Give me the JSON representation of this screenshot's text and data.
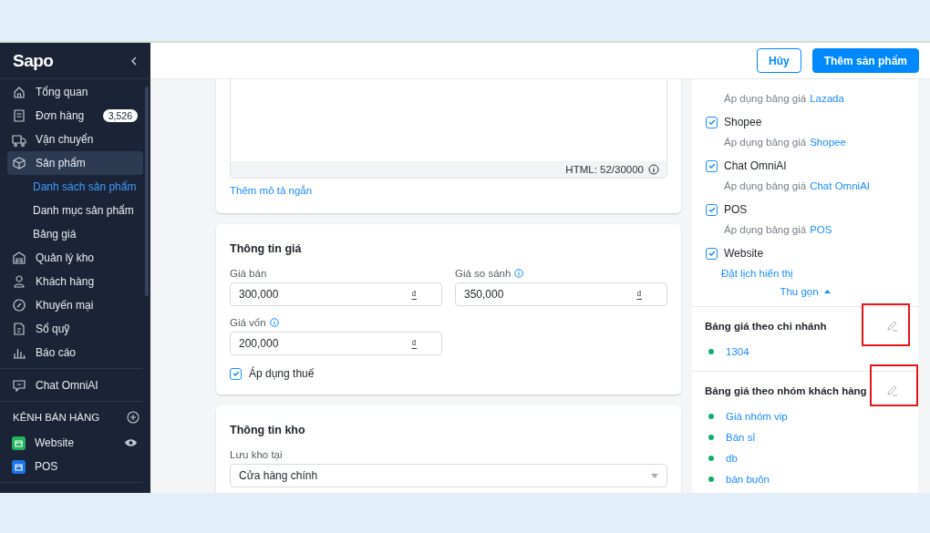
{
  "sidebar": {
    "logo": "Sapo",
    "items": [
      {
        "label": "Tổng quan",
        "selected": false
      },
      {
        "label": "Đơn hàng",
        "badge": "3,526",
        "selected": false
      },
      {
        "label": "Vận chuyển",
        "selected": false
      },
      {
        "label": "Sản phẩm",
        "selected": true,
        "children": [
          {
            "label": "Danh sách sản phẩm",
            "selected": true
          },
          {
            "label": "Danh mục sản phẩm",
            "selected": false
          },
          {
            "label": "Bảng giá",
            "selected": false
          }
        ]
      },
      {
        "label": "Quản lý kho",
        "selected": false
      },
      {
        "label": "Khách hàng",
        "selected": false
      },
      {
        "label": "Khuyến mại",
        "selected": false
      },
      {
        "label": "Sổ quỹ",
        "selected": false
      },
      {
        "label": "Báo cáo",
        "selected": false
      }
    ],
    "chat_item": {
      "label": "Chat OmniAI",
      "selected": false
    },
    "sales_channels": {
      "title": "KÊNH BÁN HÀNG",
      "items": [
        {
          "label": "Website",
          "color": "#22b35e",
          "selected": false
        },
        {
          "label": "POS",
          "color": "#1a73e8",
          "selected": false
        }
      ]
    }
  },
  "topbar": {
    "buttons": [
      {
        "label": "Hủy",
        "kind": "outline"
      },
      {
        "label": "Thêm sản phẩm",
        "kind": "primary"
      }
    ]
  },
  "description_card": {
    "counter": "HTML: 52/30000",
    "link": "Thêm mô tả ngắn"
  },
  "price_card": {
    "title": "Thông tin giá",
    "fields": [
      {
        "label": "Giá bán",
        "value": "300,000",
        "unit": "₫",
        "info": false
      },
      {
        "label": "Giá so sánh",
        "value": "350,000",
        "unit": "₫",
        "info": true
      },
      {
        "label": "Giá vốn",
        "value": "200,000",
        "unit": "₫",
        "info": true
      }
    ],
    "tax": {
      "label": "Áp dụng thuế",
      "checked": true
    }
  },
  "stock_card": {
    "title": "Thông tin kho",
    "label": "Lưu kho tại",
    "value": "Cửa hàng chính"
  },
  "channels_panel": {
    "items": [
      {
        "prefix": "Áp dụng bảng giá",
        "price_list": "Lazada"
      },
      {
        "name": "Shopee",
        "checked": true,
        "prefix": "Áp dụng bảng giá",
        "price_list": "Shopee"
      },
      {
        "name": "Chat OmniAI",
        "checked": true,
        "prefix": "Áp dụng bảng giá",
        "price_list": "Chat OmniAI"
      },
      {
        "name": "POS",
        "checked": true,
        "prefix": "Áp dụng bảng giá",
        "price_list": "POS"
      },
      {
        "name": "Website",
        "checked": true,
        "link": "Đặt lịch hiển thị"
      }
    ],
    "collapse": "Thu gọn"
  },
  "price_panels": [
    {
      "title": "Bảng giá theo chi nhánh",
      "highlighted": true,
      "items": [
        "1304"
      ]
    },
    {
      "title": "Bảng giá theo nhóm khách hàng",
      "highlighted": true,
      "items": [
        "Giá nhóm vip",
        "Bán sỉ",
        "db",
        "bán buôn"
      ]
    }
  ]
}
